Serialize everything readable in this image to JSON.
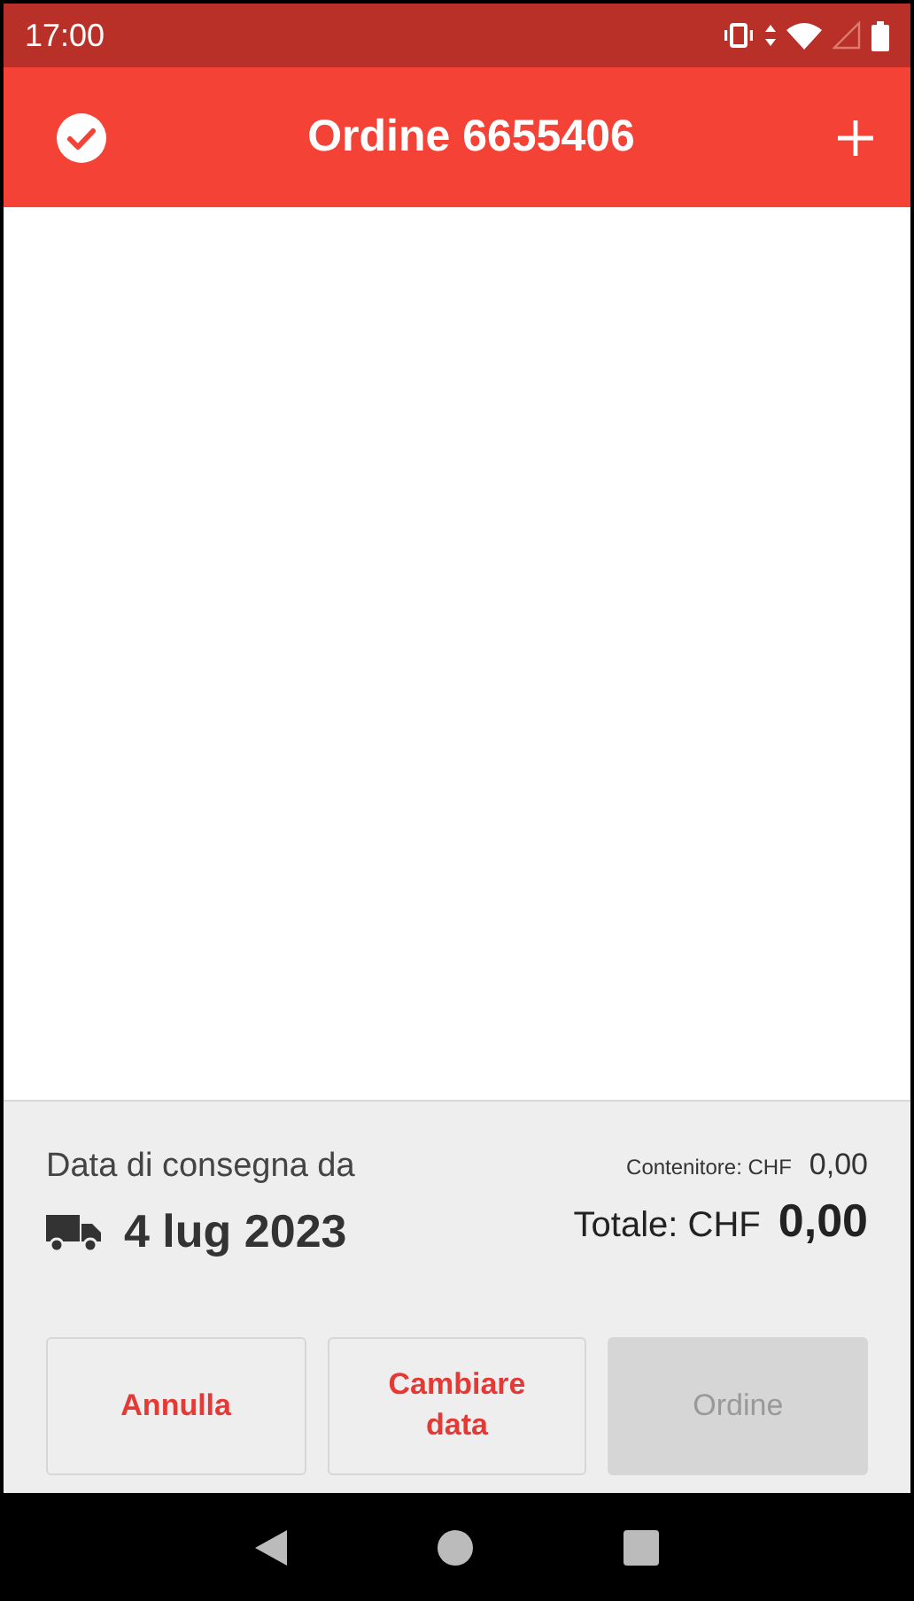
{
  "status_bar": {
    "time": "17:00"
  },
  "app_bar": {
    "title": "Ordine 6655406"
  },
  "delivery": {
    "label": "Data di consegna da",
    "date": "4 lug 2023"
  },
  "totals": {
    "container_label": "Contenitore: CHF",
    "container_value": "0,00",
    "total_label": "Totale: CHF",
    "total_value": "0,00"
  },
  "buttons": [
    {
      "label": "Annulla",
      "disabled": false
    },
    {
      "label": "Cambiare data",
      "disabled": false
    },
    {
      "label": "Ordine",
      "disabled": true
    }
  ]
}
